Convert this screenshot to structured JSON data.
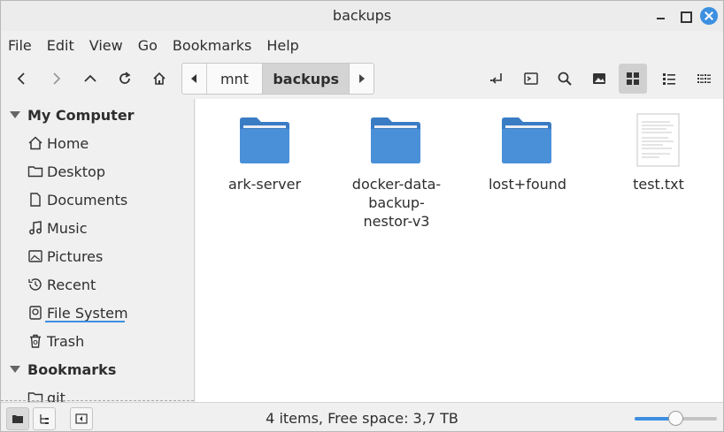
{
  "window": {
    "title": "backups"
  },
  "menu": [
    "File",
    "Edit",
    "View",
    "Go",
    "Bookmarks",
    "Help"
  ],
  "toolbar": {
    "nav_icons": [
      "back-icon",
      "forward-icon",
      "up-icon",
      "reload-icon",
      "home-icon"
    ],
    "path": [
      "mnt",
      "backups"
    ],
    "right_icons": [
      "open-terminal-here-icon",
      "terminal-icon",
      "search-icon",
      "thumbnail-icon",
      "icon-view-icon",
      "list-view-icon",
      "compact-view-icon"
    ],
    "active_view": "icon-view"
  },
  "sidebar": {
    "sections": [
      {
        "label": "My Computer",
        "items": [
          {
            "label": "Home",
            "icon": "home-icon"
          },
          {
            "label": "Desktop",
            "icon": "folder-icon"
          },
          {
            "label": "Documents",
            "icon": "document-icon"
          },
          {
            "label": "Music",
            "icon": "music-icon"
          },
          {
            "label": "Pictures",
            "icon": "picture-icon"
          },
          {
            "label": "Recent",
            "icon": "recent-icon"
          },
          {
            "label": "File System",
            "icon": "drive-icon"
          },
          {
            "label": "Trash",
            "icon": "trash-icon"
          }
        ]
      },
      {
        "label": "Bookmarks",
        "items": [
          {
            "label": "git",
            "icon": "folder-icon"
          }
        ]
      }
    ]
  },
  "files": [
    {
      "name": "ark-server",
      "type": "folder"
    },
    {
      "name": "docker-data-backup-nestor-v3",
      "display_lines": [
        "docker-data-",
        "backup-",
        "nestor-v3"
      ],
      "type": "folder"
    },
    {
      "name": "lost+found",
      "type": "folder"
    },
    {
      "name": "test.txt",
      "type": "text"
    }
  ],
  "statusbar": {
    "text": "4 items, Free space: 3,7 TB",
    "zoom_fraction": 0.5
  },
  "colors": {
    "accent": "#3d8fe0",
    "folder": "#4a90d9",
    "folder_dark": "#3a7cc4"
  }
}
